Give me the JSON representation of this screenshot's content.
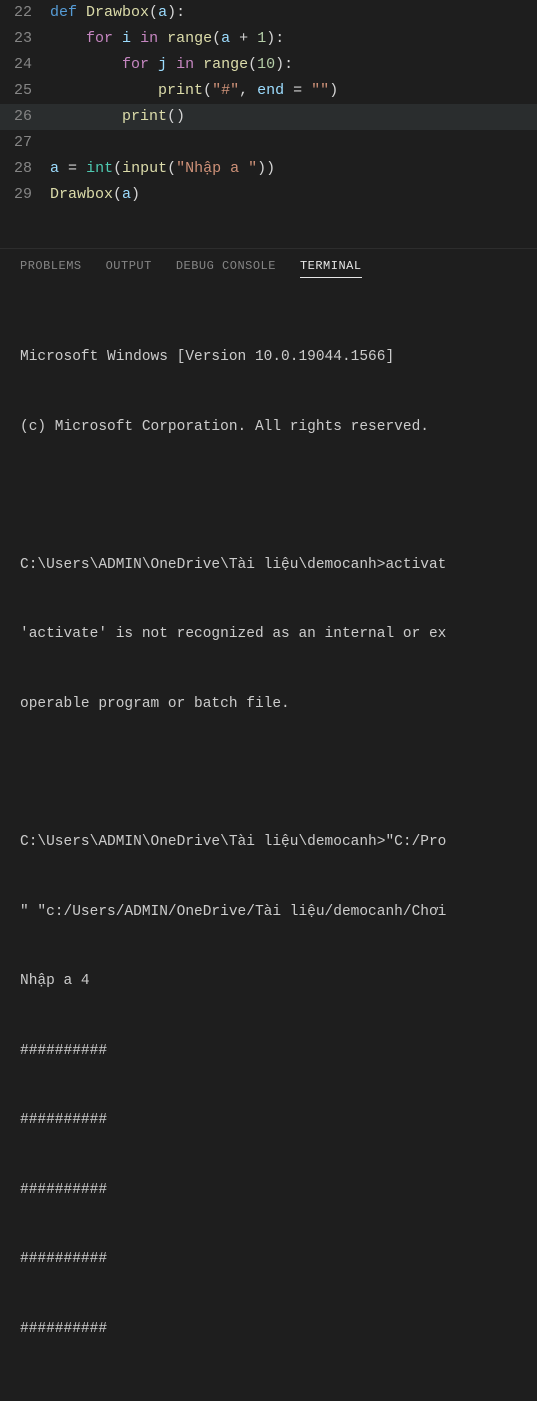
{
  "editor": {
    "lines": [
      {
        "num": "22",
        "highlighted": false
      },
      {
        "num": "23",
        "highlighted": false
      },
      {
        "num": "24",
        "highlighted": false
      },
      {
        "num": "25",
        "highlighted": false
      },
      {
        "num": "26",
        "highlighted": true
      },
      {
        "num": "27",
        "highlighted": false
      },
      {
        "num": "28",
        "highlighted": false
      },
      {
        "num": "29",
        "highlighted": false
      }
    ],
    "tokens": {
      "def": "def",
      "Drawbox": "Drawbox",
      "a": "a",
      "for": "for",
      "i": "i",
      "j": "j",
      "in": "in",
      "range": "range",
      "plus": "+",
      "one": "1",
      "ten": "10",
      "print": "print",
      "hash": "\"#\"",
      "end": "end",
      "eq": "=",
      "empty": "\"\"",
      "input": "input",
      "int": "int",
      "nhap": "\"Nhập a \"",
      "colon": ":",
      "lp": "(",
      "rp": ")",
      "comma": ","
    }
  },
  "panel": {
    "tabs": {
      "problems": "PROBLEMS",
      "output": "OUTPUT",
      "debug": "DEBUG CONSOLE",
      "terminal": "TERMINAL"
    }
  },
  "terminal": {
    "lines": [
      "Microsoft Windows [Version 10.0.19044.1566]",
      "(c) Microsoft Corporation. All rights reserved.",
      "",
      "C:\\Users\\ADMIN\\OneDrive\\Tài liệu\\democanh>activat",
      "'activate' is not recognized as an internal or ex",
      "operable program or batch file.",
      "",
      "C:\\Users\\ADMIN\\OneDrive\\Tài liệu\\democanh>\"C:/Pro",
      "\" \"c:/Users/ADMIN/OneDrive/Tài liệu/democanh/Chơi",
      "Nhập a 4",
      "##########",
      "##########",
      "##########",
      "##########",
      "##########"
    ]
  }
}
